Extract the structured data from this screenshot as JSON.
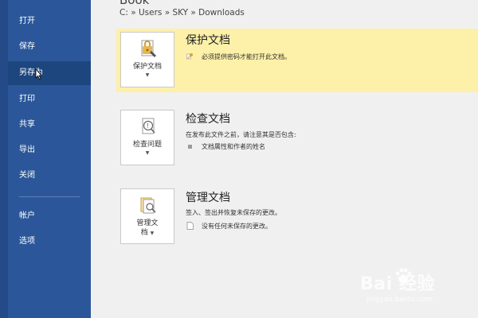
{
  "sidebar": {
    "items": [
      {
        "label": "打开"
      },
      {
        "label": "保存"
      },
      {
        "label": "另存为"
      },
      {
        "label": "打印"
      },
      {
        "label": "共享"
      },
      {
        "label": "导出"
      },
      {
        "label": "关闭"
      },
      {
        "label": "帐户"
      },
      {
        "label": "选项"
      }
    ],
    "active_index": 2
  },
  "header": {
    "title_fragment": "Book",
    "path": "C: » Users » SKY » Downloads"
  },
  "protect": {
    "button_label": "保护文档",
    "title": "保护文档",
    "desc": "必须提供密码才能打开此文档。"
  },
  "inspect": {
    "button_label": "检查问题",
    "title": "检查文档",
    "desc": "在发布此文件之前，请注意其是否包含:",
    "bullet": "文档属性和作者的姓名"
  },
  "manage": {
    "button_label_line1": "管理文",
    "button_label_line2": "档",
    "title": "管理文档",
    "desc": "签入、签出并恢复未保存的更改。",
    "sub": "没有任何未保存的更改。"
  },
  "watermark": {
    "brand": "Bai 经验",
    "url": "jingyan.baidu.com"
  },
  "colors": {
    "sidebar": "#2b579a",
    "active": "#1e467e",
    "band": "#fdf0a8",
    "background": "#f1f0f1"
  }
}
